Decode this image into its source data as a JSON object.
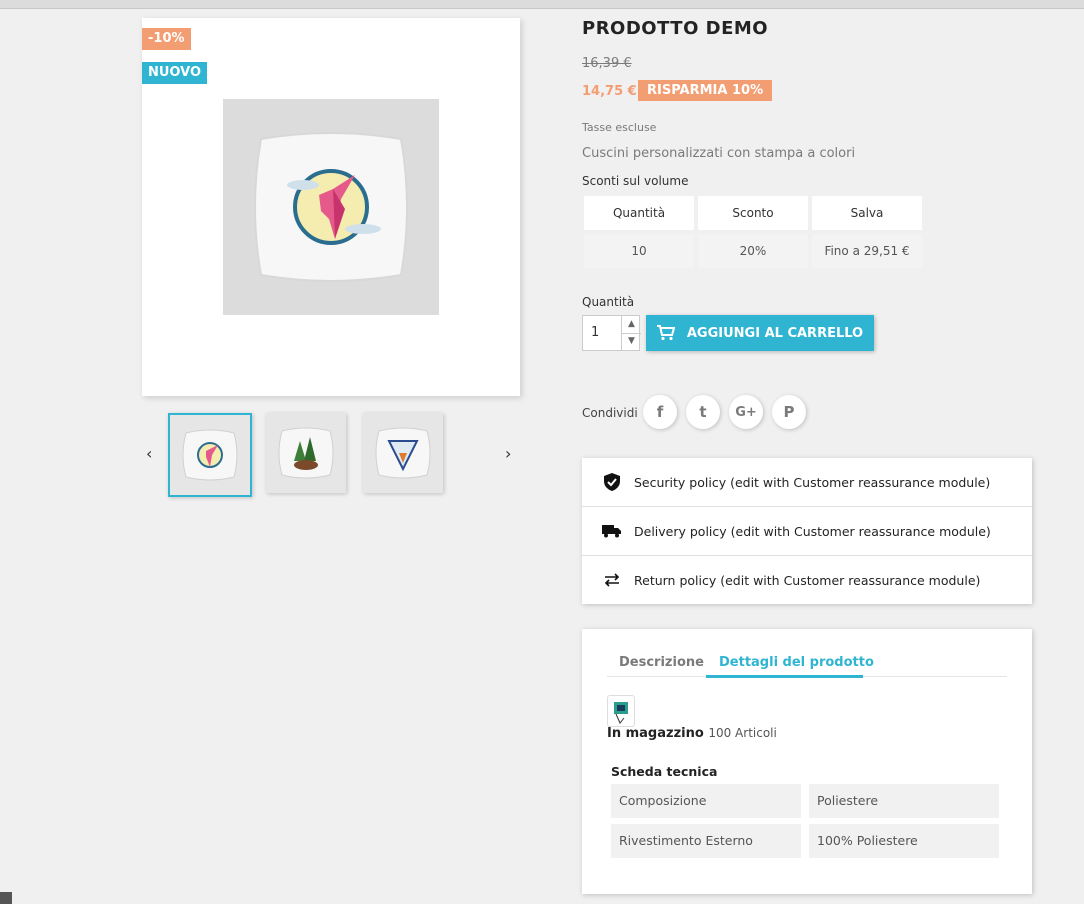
{
  "product": {
    "title": "PRODOTTO DEMO",
    "flags": {
      "discount": "-10%",
      "new": "NUOVO"
    },
    "regular_price": "16,39 €",
    "price": "14,75 €",
    "discount_badge": "RISPARMIA 10%",
    "tax_note": "Tasse escluse",
    "short_description": "Cuscini personalizzati con stampa a colori"
  },
  "gallery": {
    "thumbnails": [
      {
        "icon": "hummingbird-pillow-icon",
        "selected": true
      },
      {
        "icon": "bear-forest-pillow-icon",
        "selected": false
      },
      {
        "icon": "fox-triangle-pillow-icon",
        "selected": false
      }
    ],
    "prev_icon": "chevron-left-icon",
    "next_icon": "chevron-right-icon"
  },
  "volume_discounts": {
    "title": "Sconti sul volume",
    "headers": [
      "Quantità",
      "Sconto",
      "Salva"
    ],
    "rows": [
      [
        "10",
        "20%",
        "Fino a 29,51 €"
      ]
    ]
  },
  "cart": {
    "quantity_label": "Quantità",
    "quantity_value": "1",
    "add_button": "AGGIUNGI AL CARRELLO"
  },
  "share": {
    "label": "Condividi",
    "networks": [
      {
        "name": "facebook",
        "glyph": "f"
      },
      {
        "name": "twitter",
        "glyph": "t"
      },
      {
        "name": "google-plus",
        "glyph": "G+"
      },
      {
        "name": "pinterest",
        "glyph": "P"
      }
    ]
  },
  "reassurance": [
    {
      "icon": "shield-icon",
      "text": "Security policy (edit with Customer reassurance module)"
    },
    {
      "icon": "truck-icon",
      "text": "Delivery policy (edit with Customer reassurance module)"
    },
    {
      "icon": "swap-arrows-icon",
      "text": "Return policy (edit with Customer reassurance module)"
    }
  ],
  "tabs": {
    "items": [
      {
        "label": "Descrizione",
        "active": false
      },
      {
        "label": "Dettagli del prodotto",
        "active": true
      }
    ],
    "stock_label": "In magazzino",
    "stock_count": "100 Articoli",
    "sheet_title": "Scheda tecnica",
    "sheet": [
      [
        "Composizione",
        "Poliestere"
      ],
      [
        "Rivestimento Esterno",
        "100% Poliestere"
      ]
    ]
  },
  "colors": {
    "accent": "#2fb5d2",
    "discount": "#f39d72"
  }
}
